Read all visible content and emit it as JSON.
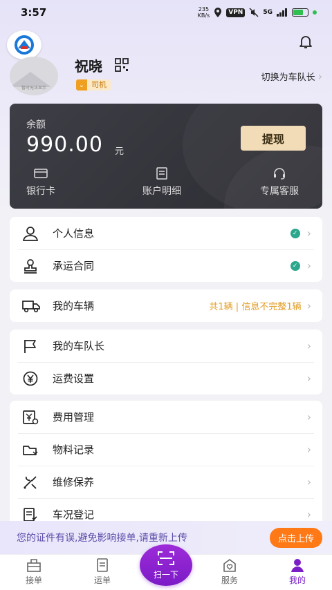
{
  "status_bar": {
    "time": "3:57",
    "net_speed_value": "235",
    "net_speed_unit": "KB/s",
    "vpn": "VPN",
    "signal": "5G",
    "battery_color": "#2fbf4f"
  },
  "profile": {
    "name": "祝晓",
    "role": "司机",
    "avatar_caption": "暂时无法显示",
    "switch_label": "切换为车队长"
  },
  "balance": {
    "label": "余额",
    "amount": "990.00",
    "unit": "元",
    "withdraw_label": "提现",
    "actions": [
      {
        "label": "银行卡",
        "icon": "bank-card-icon"
      },
      {
        "label": "账户明细",
        "icon": "account-details-icon"
      },
      {
        "label": "专属客服",
        "icon": "headset-icon"
      }
    ]
  },
  "menu": {
    "group1": [
      {
        "label": "个人信息",
        "icon": "user-icon",
        "verified": true
      },
      {
        "label": "承运合同",
        "icon": "stamp-icon",
        "verified": true
      }
    ],
    "vehicle": {
      "label": "我的车辆",
      "icon": "truck-icon",
      "status": "共1辆 | 信息不完整1辆"
    },
    "group3": [
      {
        "label": "我的车队长",
        "icon": "flag-icon"
      },
      {
        "label": "运费设置",
        "icon": "yen-icon"
      }
    ],
    "group4": [
      {
        "label": "费用管理",
        "icon": "expense-icon"
      },
      {
        "label": "物料记录",
        "icon": "material-icon"
      },
      {
        "label": "维修保养",
        "icon": "tools-icon"
      },
      {
        "label": "车况登记",
        "icon": "checklist-icon"
      }
    ]
  },
  "notice": {
    "text": "您的证件有误,避免影响接单,请重新上传",
    "button": "点击上传"
  },
  "tabbar": {
    "tabs": [
      {
        "label": "接单",
        "icon": "order-take-icon"
      },
      {
        "label": "运单",
        "icon": "waybill-icon"
      },
      {
        "label": "服务",
        "icon": "service-icon"
      },
      {
        "label": "我的",
        "icon": "profile-icon",
        "active": true
      }
    ],
    "scan_label": "扫一下",
    "accent": "#7a1fc8"
  }
}
